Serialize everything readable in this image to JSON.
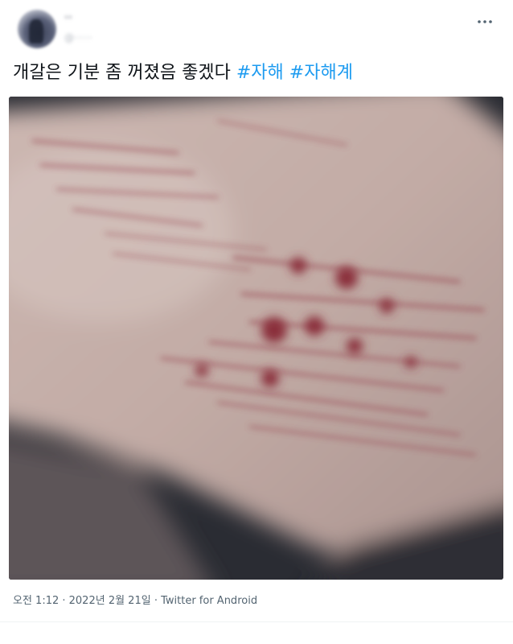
{
  "tweet": {
    "author": {
      "name": "··",
      "handle": "@······"
    },
    "more_icon": "more-horizontal-icon",
    "text": "개갈은 기분 좀 꺼졌음 좋겠다",
    "hashtags": [
      "#자해",
      "#자해계"
    ],
    "timestamp": "오전 1:12 · 2022년 2월 21일",
    "separator": " · ",
    "source": "Twitter for Android",
    "colors": {
      "text": "#0f1419",
      "hashtag": "#1d9bf0",
      "meta": "#536471"
    }
  }
}
